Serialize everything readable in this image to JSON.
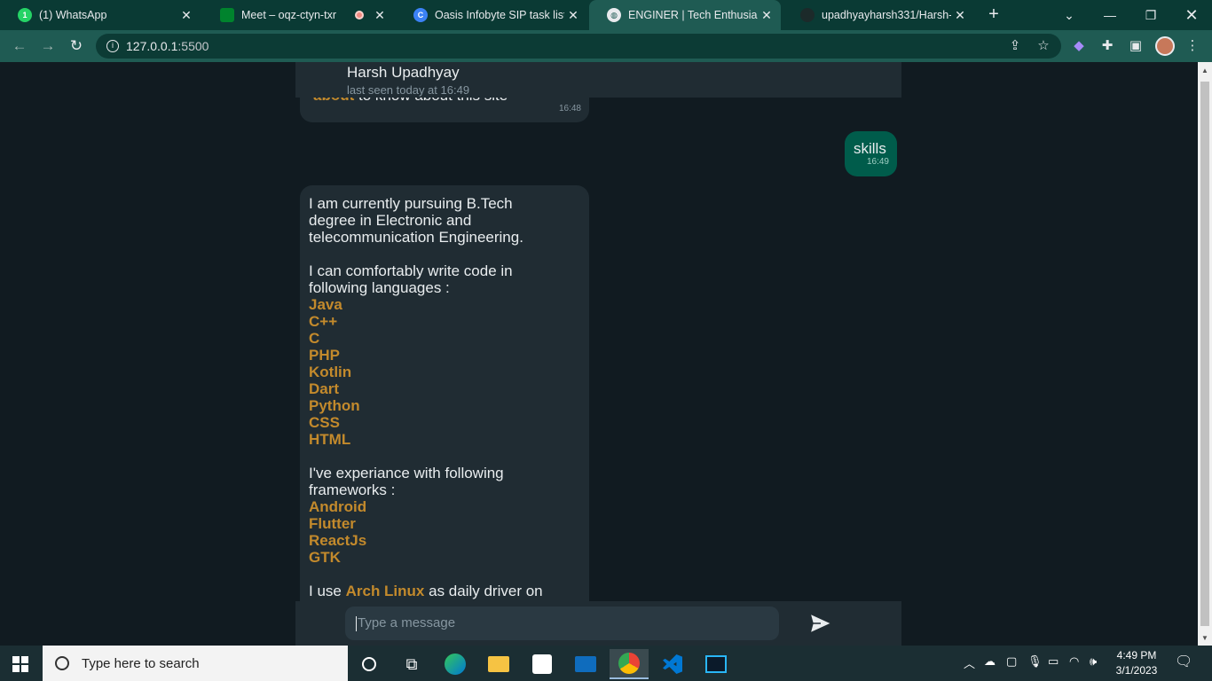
{
  "browser": {
    "tabs": [
      {
        "title": "(1) WhatsApp",
        "favicon": "whatsapp-icon"
      },
      {
        "title": "Meet – oqz-ctyn-txr",
        "favicon": "meet-icon"
      },
      {
        "title": "Oasis Infobyte SIP task list - P",
        "favicon": "canva-icon"
      },
      {
        "title": "ENGINER | Tech Enthusiast |",
        "favicon": "globe-icon"
      },
      {
        "title": "upadhyayharsh331/Harsh-Up",
        "favicon": "github-icon"
      }
    ],
    "url_host": "127.0.0.1",
    "url_port": ":5500"
  },
  "chat": {
    "contact_name": "Harsh Upadhyay",
    "contact_status": "last seen today at 16:49",
    "partial_message": {
      "highlight": "about",
      "text": " to know about this site",
      "time": "16:48"
    },
    "sent_message": {
      "text": "skills",
      "time": "16:49"
    },
    "reply": {
      "intro": "I am currently pursuing B.Tech degree in Electronic and telecommunication Engineering.",
      "languages_intro": "I can comfortably write code in following languages :",
      "languages": [
        "Java",
        "C++",
        "C",
        "PHP",
        "Kotlin",
        "Dart",
        "Python",
        "CSS",
        "HTML"
      ],
      "frameworks_intro": "I've experiance with following frameworks :",
      "frameworks": [
        "Android",
        "Flutter",
        "ReactJs",
        "GTK"
      ],
      "os_prefix": "I use ",
      "os_highlight": "Arch Linux",
      "os_suffix": " as daily driver on"
    },
    "input_placeholder": "Type a message"
  },
  "taskbar": {
    "search_placeholder": "Type here to search",
    "time": "4:49 PM",
    "date": "3/1/2023"
  },
  "colors": {
    "browser_frame": "#0a3a34",
    "chat_background": "#111b21",
    "incoming_bubble": "#202c33",
    "outgoing_bubble": "#005c4b",
    "highlight_text": "#c38a2c"
  }
}
